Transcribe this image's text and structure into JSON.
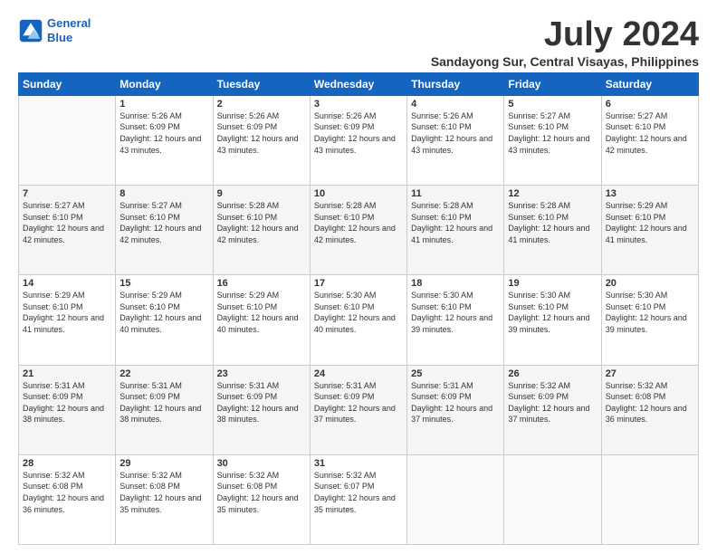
{
  "logo": {
    "line1": "General",
    "line2": "Blue"
  },
  "title": "July 2024",
  "location": "Sandayong Sur, Central Visayas, Philippines",
  "weekdays": [
    "Sunday",
    "Monday",
    "Tuesday",
    "Wednesday",
    "Thursday",
    "Friday",
    "Saturday"
  ],
  "weeks": [
    [
      {
        "day": "",
        "sunrise": "",
        "sunset": "",
        "daylight": ""
      },
      {
        "day": "1",
        "sunrise": "Sunrise: 5:26 AM",
        "sunset": "Sunset: 6:09 PM",
        "daylight": "Daylight: 12 hours and 43 minutes."
      },
      {
        "day": "2",
        "sunrise": "Sunrise: 5:26 AM",
        "sunset": "Sunset: 6:09 PM",
        "daylight": "Daylight: 12 hours and 43 minutes."
      },
      {
        "day": "3",
        "sunrise": "Sunrise: 5:26 AM",
        "sunset": "Sunset: 6:09 PM",
        "daylight": "Daylight: 12 hours and 43 minutes."
      },
      {
        "day": "4",
        "sunrise": "Sunrise: 5:26 AM",
        "sunset": "Sunset: 6:10 PM",
        "daylight": "Daylight: 12 hours and 43 minutes."
      },
      {
        "day": "5",
        "sunrise": "Sunrise: 5:27 AM",
        "sunset": "Sunset: 6:10 PM",
        "daylight": "Daylight: 12 hours and 43 minutes."
      },
      {
        "day": "6",
        "sunrise": "Sunrise: 5:27 AM",
        "sunset": "Sunset: 6:10 PM",
        "daylight": "Daylight: 12 hours and 42 minutes."
      }
    ],
    [
      {
        "day": "7",
        "sunrise": "Sunrise: 5:27 AM",
        "sunset": "Sunset: 6:10 PM",
        "daylight": "Daylight: 12 hours and 42 minutes."
      },
      {
        "day": "8",
        "sunrise": "Sunrise: 5:27 AM",
        "sunset": "Sunset: 6:10 PM",
        "daylight": "Daylight: 12 hours and 42 minutes."
      },
      {
        "day": "9",
        "sunrise": "Sunrise: 5:28 AM",
        "sunset": "Sunset: 6:10 PM",
        "daylight": "Daylight: 12 hours and 42 minutes."
      },
      {
        "day": "10",
        "sunrise": "Sunrise: 5:28 AM",
        "sunset": "Sunset: 6:10 PM",
        "daylight": "Daylight: 12 hours and 42 minutes."
      },
      {
        "day": "11",
        "sunrise": "Sunrise: 5:28 AM",
        "sunset": "Sunset: 6:10 PM",
        "daylight": "Daylight: 12 hours and 41 minutes."
      },
      {
        "day": "12",
        "sunrise": "Sunrise: 5:28 AM",
        "sunset": "Sunset: 6:10 PM",
        "daylight": "Daylight: 12 hours and 41 minutes."
      },
      {
        "day": "13",
        "sunrise": "Sunrise: 5:29 AM",
        "sunset": "Sunset: 6:10 PM",
        "daylight": "Daylight: 12 hours and 41 minutes."
      }
    ],
    [
      {
        "day": "14",
        "sunrise": "Sunrise: 5:29 AM",
        "sunset": "Sunset: 6:10 PM",
        "daylight": "Daylight: 12 hours and 41 minutes."
      },
      {
        "day": "15",
        "sunrise": "Sunrise: 5:29 AM",
        "sunset": "Sunset: 6:10 PM",
        "daylight": "Daylight: 12 hours and 40 minutes."
      },
      {
        "day": "16",
        "sunrise": "Sunrise: 5:29 AM",
        "sunset": "Sunset: 6:10 PM",
        "daylight": "Daylight: 12 hours and 40 minutes."
      },
      {
        "day": "17",
        "sunrise": "Sunrise: 5:30 AM",
        "sunset": "Sunset: 6:10 PM",
        "daylight": "Daylight: 12 hours and 40 minutes."
      },
      {
        "day": "18",
        "sunrise": "Sunrise: 5:30 AM",
        "sunset": "Sunset: 6:10 PM",
        "daylight": "Daylight: 12 hours and 39 minutes."
      },
      {
        "day": "19",
        "sunrise": "Sunrise: 5:30 AM",
        "sunset": "Sunset: 6:10 PM",
        "daylight": "Daylight: 12 hours and 39 minutes."
      },
      {
        "day": "20",
        "sunrise": "Sunrise: 5:30 AM",
        "sunset": "Sunset: 6:10 PM",
        "daylight": "Daylight: 12 hours and 39 minutes."
      }
    ],
    [
      {
        "day": "21",
        "sunrise": "Sunrise: 5:31 AM",
        "sunset": "Sunset: 6:09 PM",
        "daylight": "Daylight: 12 hours and 38 minutes."
      },
      {
        "day": "22",
        "sunrise": "Sunrise: 5:31 AM",
        "sunset": "Sunset: 6:09 PM",
        "daylight": "Daylight: 12 hours and 38 minutes."
      },
      {
        "day": "23",
        "sunrise": "Sunrise: 5:31 AM",
        "sunset": "Sunset: 6:09 PM",
        "daylight": "Daylight: 12 hours and 38 minutes."
      },
      {
        "day": "24",
        "sunrise": "Sunrise: 5:31 AM",
        "sunset": "Sunset: 6:09 PM",
        "daylight": "Daylight: 12 hours and 37 minutes."
      },
      {
        "day": "25",
        "sunrise": "Sunrise: 5:31 AM",
        "sunset": "Sunset: 6:09 PM",
        "daylight": "Daylight: 12 hours and 37 minutes."
      },
      {
        "day": "26",
        "sunrise": "Sunrise: 5:32 AM",
        "sunset": "Sunset: 6:09 PM",
        "daylight": "Daylight: 12 hours and 37 minutes."
      },
      {
        "day": "27",
        "sunrise": "Sunrise: 5:32 AM",
        "sunset": "Sunset: 6:08 PM",
        "daylight": "Daylight: 12 hours and 36 minutes."
      }
    ],
    [
      {
        "day": "28",
        "sunrise": "Sunrise: 5:32 AM",
        "sunset": "Sunset: 6:08 PM",
        "daylight": "Daylight: 12 hours and 36 minutes."
      },
      {
        "day": "29",
        "sunrise": "Sunrise: 5:32 AM",
        "sunset": "Sunset: 6:08 PM",
        "daylight": "Daylight: 12 hours and 35 minutes."
      },
      {
        "day": "30",
        "sunrise": "Sunrise: 5:32 AM",
        "sunset": "Sunset: 6:08 PM",
        "daylight": "Daylight: 12 hours and 35 minutes."
      },
      {
        "day": "31",
        "sunrise": "Sunrise: 5:32 AM",
        "sunset": "Sunset: 6:07 PM",
        "daylight": "Daylight: 12 hours and 35 minutes."
      },
      {
        "day": "",
        "sunrise": "",
        "sunset": "",
        "daylight": ""
      },
      {
        "day": "",
        "sunrise": "",
        "sunset": "",
        "daylight": ""
      },
      {
        "day": "",
        "sunrise": "",
        "sunset": "",
        "daylight": ""
      }
    ]
  ]
}
